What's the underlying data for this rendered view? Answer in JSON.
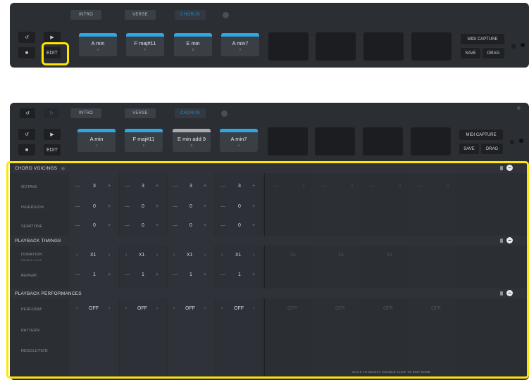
{
  "tabs": [
    "INTRO",
    "VERSE",
    "CHORUS"
  ],
  "controls": {
    "undo": "↺",
    "redo": "↻",
    "restart": "↺",
    "play": "▶",
    "stop": "■",
    "edit": "EDIT"
  },
  "right_buttons": {
    "midi_capture": "MIDI CAPTURE",
    "save": "SAVE",
    "drag": "DRAG"
  },
  "top_chords": [
    {
      "name": "A min",
      "sub": "A"
    },
    {
      "name": "F maj#11",
      "sub": "F"
    },
    {
      "name": "E min",
      "sub": "E"
    },
    {
      "name": "A min7",
      "sub": "A"
    }
  ],
  "bottom_chords": [
    {
      "name": "A min",
      "sub": "A",
      "selected": false
    },
    {
      "name": "F maj#11",
      "sub": "F",
      "selected": false
    },
    {
      "name": "E min add 9",
      "sub": "E",
      "selected": true
    },
    {
      "name": "A min7",
      "sub": "A",
      "selected": false
    }
  ],
  "sections": {
    "voicings": {
      "title": "CHORD VOICINGS",
      "rows": [
        {
          "label": "OCTAVE",
          "values": [
            "3",
            "3",
            "3",
            "3"
          ]
        },
        {
          "label": "INVERSION",
          "values": [
            "0",
            "0",
            "0",
            "0"
          ]
        },
        {
          "label": "SEMITONE",
          "values": [
            "0",
            "0",
            "0",
            "0"
          ]
        }
      ]
    },
    "timings": {
      "title": "PLAYBACK TIMINGS",
      "rows": [
        {
          "label": "DURATION",
          "sublabel": "DOUBLE CLICK",
          "values": [
            "X1",
            "X1",
            "X1",
            "X1"
          ],
          "faint": [
            "X1",
            "X1",
            "X1"
          ]
        },
        {
          "label": "REPEAT",
          "values": [
            "1",
            "1",
            "1",
            "1"
          ]
        }
      ]
    },
    "performances": {
      "title": "PLAYBACK PERFORMANCES",
      "rows": [
        {
          "label": "PERFORM",
          "values": [
            "OFF",
            "OFF",
            "OFF",
            "OFF"
          ],
          "faint": [
            "OFF",
            "OFF",
            "OFF",
            "OFF"
          ]
        },
        {
          "label": "PATTERN"
        },
        {
          "label": "RESOLUTION"
        }
      ]
    }
  },
  "symbols": {
    "minus": "—",
    "plus": "+",
    "lt": "‹",
    "gt": "›",
    "collapse": "−"
  },
  "footer_hint": "CLICK TO SELECT, DOUBLE CLICK TO EDIT NAME",
  "colors": {
    "accent": "#2da7e6",
    "highlight": "#ffe600",
    "panel": "#2b2e33"
  }
}
